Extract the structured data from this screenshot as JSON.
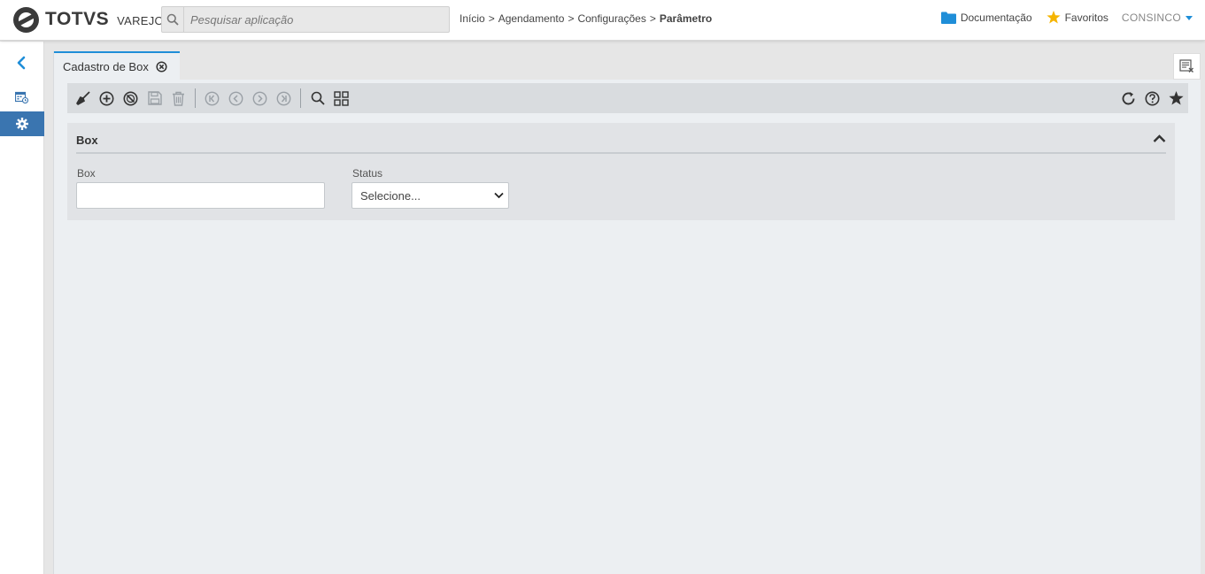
{
  "header": {
    "logo_text": "TOTVS",
    "logo_sub": "VAREJO",
    "search_placeholder": "Pesquisar aplicação",
    "breadcrumb": [
      "Início",
      ">",
      "Agendamento",
      ">",
      "Configurações",
      ">",
      "Parâmetro"
    ],
    "documentation_label": "Documentação",
    "favorites_label": "Favoritos",
    "user_label": "CONSINCO"
  },
  "sidebar": {
    "items": [
      {
        "icon": "chevron-left-icon"
      },
      {
        "icon": "calendar-icon"
      },
      {
        "icon": "gear-icon",
        "active": true
      }
    ]
  },
  "tabs": [
    {
      "label": "Cadastro de Box",
      "active": true
    }
  ],
  "panel": {
    "title": "Box",
    "fields": {
      "box_label": "Box",
      "box_value": "",
      "status_label": "Status",
      "status_value": "Selecione..."
    }
  },
  "colors": {
    "accent": "#1f8ed8",
    "sidebar_active": "#3a75b0",
    "favorite_star": "#f5b400"
  }
}
